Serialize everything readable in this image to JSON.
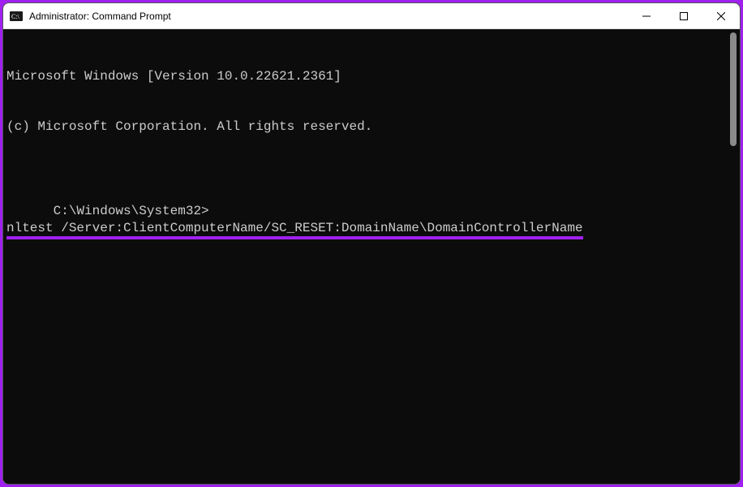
{
  "window": {
    "title": "Administrator: Command Prompt",
    "icon_name": "cmd-icon"
  },
  "terminal": {
    "line1": "Microsoft Windows [Version 10.0.22621.2361]",
    "line2": "(c) Microsoft Corporation. All rights reserved.",
    "prompt": "C:\\Windows\\System32>",
    "command": "nltest /Server:ClientComputerName/SC_RESET:DomainName\\DomainControllerName"
  },
  "colors": {
    "highlight": "#a020f0",
    "terminal_bg": "#0c0c0c",
    "terminal_fg": "#cccccc"
  }
}
